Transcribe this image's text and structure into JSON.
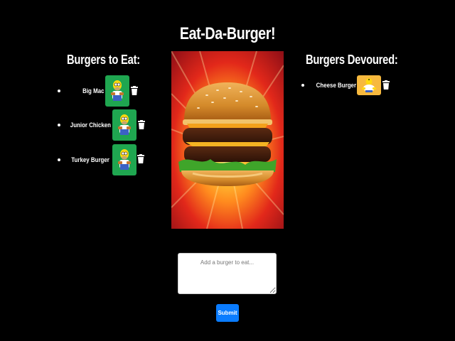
{
  "page": {
    "title": "Eat-Da-Burger!"
  },
  "to_eat": {
    "heading": "Burgers to Eat:",
    "items": [
      {
        "name": "Big Mac",
        "icon": "homer-icon"
      },
      {
        "name": "Junior Chicken",
        "icon": "homer-icon"
      },
      {
        "name": "Turkey Burger",
        "icon": "homer-icon"
      }
    ],
    "button_color": "#1fa650"
  },
  "devoured": {
    "heading": "Burgers Devoured:",
    "items": [
      {
        "name": "Cheese Burger",
        "icon": "homer-satisfied-icon"
      }
    ],
    "button_color": "#f7b93e"
  },
  "form": {
    "placeholder": "Add a burger to eat...",
    "submit_label": "Submit",
    "submit_color": "#0a7cff"
  }
}
